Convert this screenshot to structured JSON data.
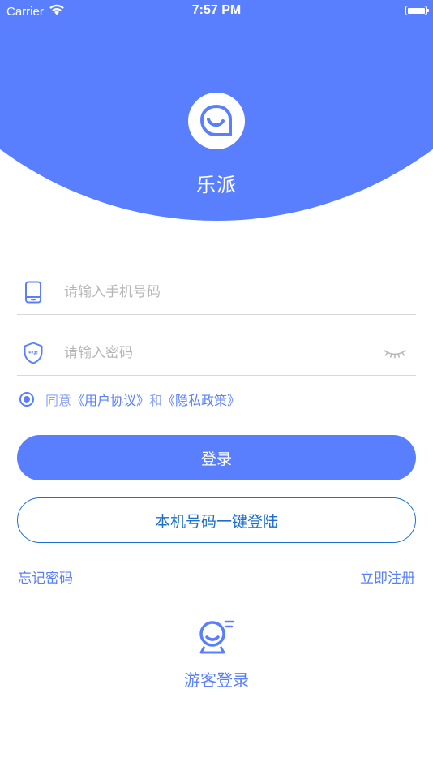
{
  "status_bar": {
    "carrier": "Carrier",
    "time": "7:57 PM"
  },
  "app": {
    "name": "乐派",
    "logo_icon": "chat-bag-logo-icon"
  },
  "form": {
    "phone_placeholder": "请输入手机号码",
    "phone_value": "",
    "password_placeholder": "请输入密码",
    "password_value": "",
    "phone_icon": "phone-icon",
    "password_icon": "shield-password-icon",
    "toggle_icon": "eye-closed-icon"
  },
  "agreement": {
    "prefix": "同意",
    "user_agreement": "《用户协议》",
    "and": "和",
    "privacy_policy": "《隐私政策》",
    "checked": true
  },
  "buttons": {
    "login": "登录",
    "one_key_login": "本机号码一键登陆",
    "forgot_password": "忘记密码",
    "register": "立即注册",
    "guest_login": "游客登录"
  },
  "colors": {
    "primary": "#5a7ffe",
    "outline_button": "#1d6fce",
    "placeholder": "#b6b6b6",
    "divider": "#d8d8d8"
  }
}
